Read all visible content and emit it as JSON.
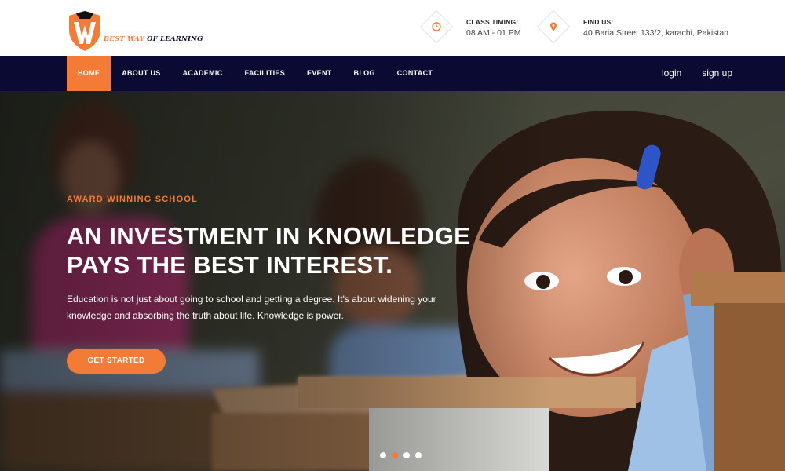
{
  "brand": {
    "logo_letter": "W",
    "tagline_part1": "BEST WAY",
    "tagline_part2": "OF LEARNING"
  },
  "header_info": {
    "timing": {
      "title": "CLASS TIMING:",
      "value": "08 AM - 01 PM",
      "icon": "clock-icon"
    },
    "location": {
      "title": "FIND US:",
      "value": "40 Baria Street 133/2, karachi, Pakistan",
      "icon": "location-pin-icon"
    }
  },
  "nav": {
    "items": [
      {
        "label": "HOME",
        "active": true
      },
      {
        "label": "ABOUT US",
        "active": false
      },
      {
        "label": "ACADEMIC",
        "active": false
      },
      {
        "label": "FACILITIES",
        "active": false
      },
      {
        "label": "EVENT",
        "active": false
      },
      {
        "label": "BLOG",
        "active": false
      },
      {
        "label": "CONTACT",
        "active": false
      }
    ],
    "login": "login",
    "signup": "sign up"
  },
  "hero": {
    "eyebrow": "AWARD WINNING SCHOOL",
    "headline_line1": "AN INVESTMENT IN KNOWLEDGE",
    "headline_line2": "PAYS THE BEST INTEREST.",
    "lead": "Education is not just about going to school and getting a degree. It's about widening your knowledge and absorbing the truth about life. Knowledge is power.",
    "cta": "GET STARTED",
    "slides": {
      "count": 4,
      "active_index": 1
    }
  },
  "colors": {
    "accent": "#f47b35",
    "nav_bg": "#0a0a33",
    "text_dark": "#2a2a2a"
  }
}
